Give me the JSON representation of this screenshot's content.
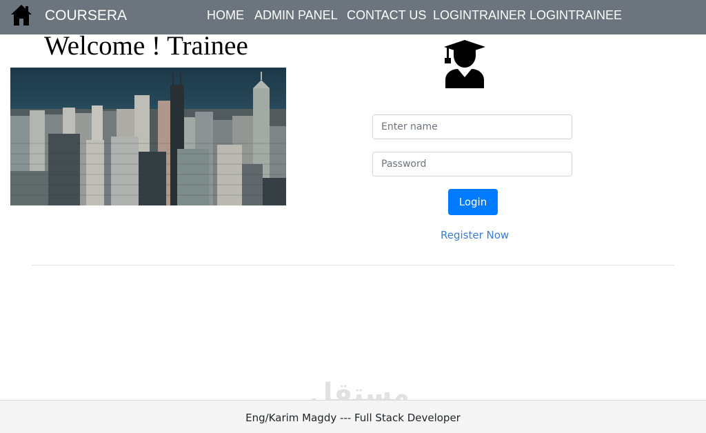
{
  "navbar": {
    "home_icon": "home-icon",
    "brand": "COURSERA",
    "links": [
      "HOME",
      "ADMIN PANEL",
      "CONTACT US",
      "LOGINTRAINER",
      "LOGINTRAINEE"
    ]
  },
  "main": {
    "welcome": "Welcome ! Trainee",
    "image": "city-skyline-photo",
    "user_icon": "graduate-icon"
  },
  "form": {
    "name_placeholder": "Enter name",
    "name_value": "",
    "password_placeholder": "Password",
    "password_value": "",
    "login_label": "Login",
    "register_label": "Register Now"
  },
  "watermark": "مستقل",
  "footer": {
    "text": "Eng/Karim Magdy --- Full Stack Developer"
  },
  "colors": {
    "navbar_bg": "#6c757d",
    "primary": "#007bff",
    "link": "#3a7bd5",
    "footer_bg": "#f5f5f5"
  }
}
